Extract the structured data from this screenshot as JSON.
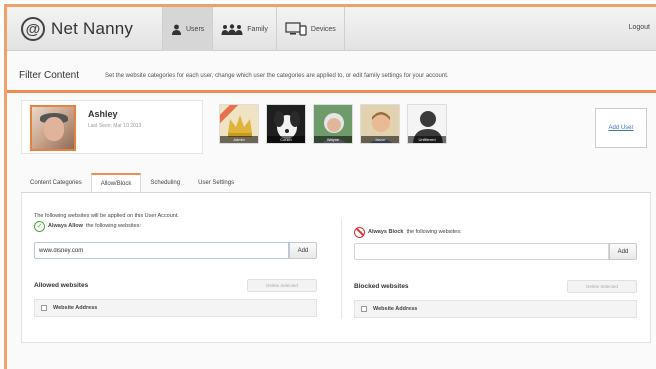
{
  "header": {
    "logo_mark": "@",
    "app_name": "Net Nanny",
    "nav": [
      {
        "label": "Users",
        "icon": "user-icon"
      },
      {
        "label": "Family",
        "icon": "family-icon"
      },
      {
        "label": "Devices",
        "icon": "devices-icon"
      }
    ],
    "logout": "Logout"
  },
  "filter": {
    "title": "Filter Content",
    "description": "Set the website categories for each user, change which user the categories are applied to, or edit family settings for your account."
  },
  "current_user": {
    "name": "Ashley",
    "last_seen": "Last Seen: Mar 10 2013"
  },
  "other_users": [
    {
      "label": "Admin",
      "bg": "#e9d9b8"
    },
    {
      "label": "Couch",
      "bg": "#1f1f1f"
    },
    {
      "label": "Wayne",
      "bg": "#5b8a5e"
    },
    {
      "label": "Jason",
      "bg": "#d8c08e"
    },
    {
      "label": "Unfiltered",
      "bg": "#3a3a3a"
    }
  ],
  "add_user": "Add User",
  "tabs": [
    "Content Categories",
    "Allow/Block",
    "Scheduling",
    "User Settings"
  ],
  "panel": {
    "applied_note": "The following websites will be applied on this User Account.",
    "allow": {
      "head_bold": "Always Allow",
      "head_rest": "the following websites:",
      "input_value": "www.disney.com",
      "add": "Add",
      "list_title": "Allowed websites",
      "delete": "Delete Selected",
      "col_header": "Website Address"
    },
    "block": {
      "head_bold": "Always Block",
      "head_rest": "the following websites:",
      "input_value": "",
      "add": "Add",
      "list_title": "Blocked websites",
      "delete": "Delete Selected",
      "col_header": "Website Address"
    }
  },
  "colors": {
    "accent": "#f08b55",
    "allow": "#4caa3c",
    "block": "#d9372e",
    "link": "#3b73b9"
  }
}
